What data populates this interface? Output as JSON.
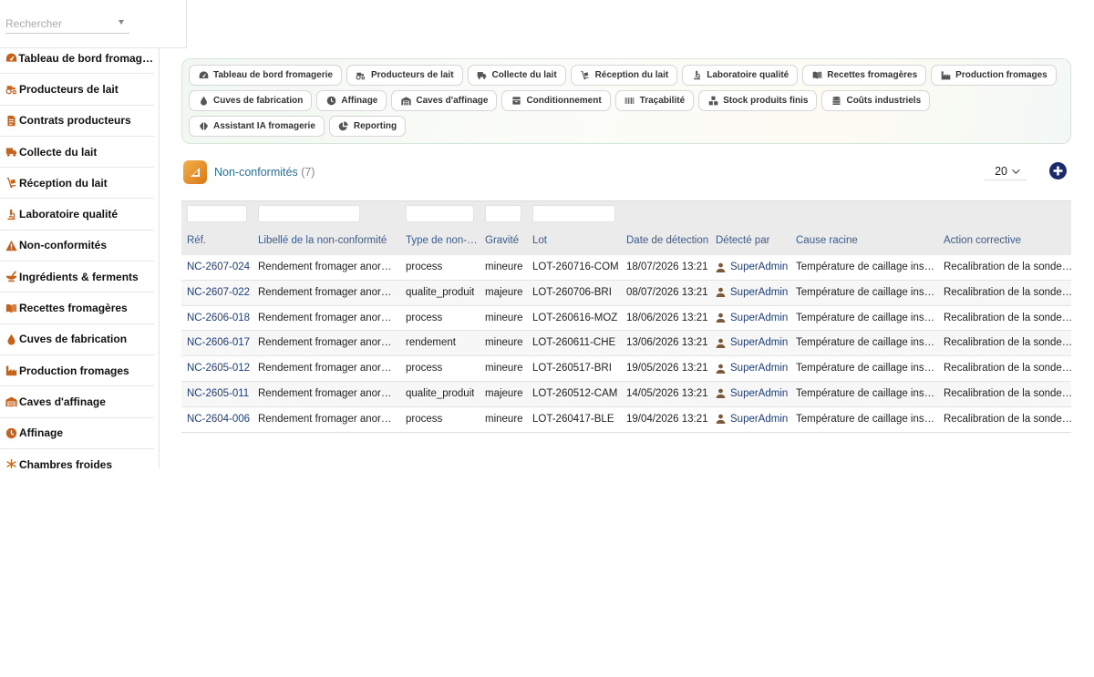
{
  "search": {
    "placeholder": "Rechercher"
  },
  "sidebar": {
    "items": [
      {
        "label": "Tableau de bord fromagerie",
        "icon": "gauge-icon",
        "name": "sidebar-item-tableau-de-bord"
      },
      {
        "label": "Producteurs de lait",
        "icon": "tractor-icon",
        "name": "sidebar-item-producteurs"
      },
      {
        "label": "Contrats producteurs",
        "icon": "contract-icon",
        "name": "sidebar-item-contrats"
      },
      {
        "label": "Collecte du lait",
        "icon": "truck-icon",
        "name": "sidebar-item-collecte"
      },
      {
        "label": "Réception du lait",
        "icon": "dolly-icon",
        "name": "sidebar-item-reception"
      },
      {
        "label": "Laboratoire qualité",
        "icon": "microscope-icon",
        "name": "sidebar-item-laboratoire"
      },
      {
        "label": "Non-conformités",
        "icon": "warning-icon",
        "name": "sidebar-item-non-conformites"
      },
      {
        "label": "Ingrédients & ferments",
        "icon": "mortar-icon",
        "name": "sidebar-item-ingredients"
      },
      {
        "label": "Recettes fromagères",
        "icon": "book-icon",
        "name": "sidebar-item-recettes"
      },
      {
        "label": "Cuves de fabrication",
        "icon": "drop-icon",
        "name": "sidebar-item-cuves"
      },
      {
        "label": "Production fromages",
        "icon": "industry-icon",
        "name": "sidebar-item-production"
      },
      {
        "label": "Caves d'affinage",
        "icon": "warehouse-icon",
        "name": "sidebar-item-caves"
      },
      {
        "label": "Affinage",
        "icon": "clock-icon",
        "name": "sidebar-item-affinage"
      },
      {
        "label": "Chambres froides",
        "icon": "snowflake-icon",
        "name": "sidebar-item-chambres"
      }
    ]
  },
  "tabs": [
    {
      "label": "Tableau de bord fromagerie",
      "icon": "gauge-icon",
      "name": "tab-tableau-de-bord"
    },
    {
      "label": "Producteurs de lait",
      "icon": "tractor-icon",
      "name": "tab-producteurs"
    },
    {
      "label": "Collecte du lait",
      "icon": "truck-icon",
      "name": "tab-collecte"
    },
    {
      "label": "Réception du lait",
      "icon": "dolly-icon",
      "name": "tab-reception"
    },
    {
      "label": "Laboratoire qualité",
      "icon": "microscope-icon",
      "name": "tab-laboratoire"
    },
    {
      "label": "Recettes fromagères",
      "icon": "book-icon",
      "name": "tab-recettes"
    },
    {
      "label": "Production fromages",
      "icon": "industry-icon",
      "name": "tab-production"
    },
    {
      "label": "Cuves de fabrication",
      "icon": "drop-icon",
      "name": "tab-cuves"
    },
    {
      "label": "Affinage",
      "icon": "clock-icon",
      "name": "tab-affinage"
    },
    {
      "label": "Caves d'affinage",
      "icon": "warehouse-icon",
      "name": "tab-caves"
    },
    {
      "label": "Conditionnement",
      "icon": "box-icon",
      "name": "tab-conditionnement"
    },
    {
      "label": "Traçabilité",
      "icon": "barcode-icon",
      "name": "tab-tracabilite"
    },
    {
      "label": "Stock produits finis",
      "icon": "boxes-icon",
      "name": "tab-stock"
    },
    {
      "label": "Coûts industriels",
      "icon": "coins-icon",
      "name": "tab-couts"
    },
    {
      "label": "Assistant IA fromagerie",
      "icon": "brain-icon",
      "name": "tab-assistant-ia"
    },
    {
      "label": "Reporting",
      "icon": "chart-pie-icon",
      "name": "tab-reporting"
    }
  ],
  "page": {
    "title": "Non-conformités",
    "count": "(7)",
    "per_page": "20"
  },
  "colors": {
    "accent_orange": "#c8611a",
    "link_blue": "#1f3d7a",
    "title_blue": "#2a6f9e",
    "add_button": "#1b2a6b"
  },
  "table": {
    "columns": [
      "Réf.",
      "Libellé de la non-conformité",
      "Type de non-conformité",
      "Gravité",
      "Lot",
      "Date de détection",
      "Détecté par",
      "Cause racine",
      "Action corrective"
    ],
    "rows": [
      [
        "NC-2607-024",
        "Rendement fromager anormal",
        "process",
        "mineure",
        "LOT-260716-COM",
        "18/07/2026 13:21",
        "SuperAdmin",
        "Température de caillage instable",
        "Recalibration de la sonde de température"
      ],
      [
        "NC-2607-022",
        "Rendement fromager anormal",
        "qualite_produit",
        "majeure",
        "LOT-260706-BRI",
        "08/07/2026 13:21",
        "SuperAdmin",
        "Température de caillage instable",
        "Recalibration de la sonde de température"
      ],
      [
        "NC-2606-018",
        "Rendement fromager anormal",
        "process",
        "mineure",
        "LOT-260616-MOZ",
        "18/06/2026 13:21",
        "SuperAdmin",
        "Température de caillage instable",
        "Recalibration de la sonde de température"
      ],
      [
        "NC-2606-017",
        "Rendement fromager anormal",
        "rendement",
        "mineure",
        "LOT-260611-CHE",
        "13/06/2026 13:21",
        "SuperAdmin",
        "Température de caillage instable",
        "Recalibration de la sonde de température"
      ],
      [
        "NC-2605-012",
        "Rendement fromager anormal",
        "process",
        "mineure",
        "LOT-260517-BRI",
        "19/05/2026 13:21",
        "SuperAdmin",
        "Température de caillage instable",
        "Recalibration de la sonde de température"
      ],
      [
        "NC-2605-011",
        "Rendement fromager anormal",
        "qualite_produit",
        "majeure",
        "LOT-260512-CAM",
        "14/05/2026 13:21",
        "SuperAdmin",
        "Température de caillage instable",
        "Recalibration de la sonde de température"
      ],
      [
        "NC-2604-006",
        "Rendement fromager anormal",
        "process",
        "mineure",
        "LOT-260417-BLE",
        "19/04/2026 13:21",
        "SuperAdmin",
        "Température de caillage instable",
        "Recalibration de la sonde de température"
      ]
    ]
  }
}
